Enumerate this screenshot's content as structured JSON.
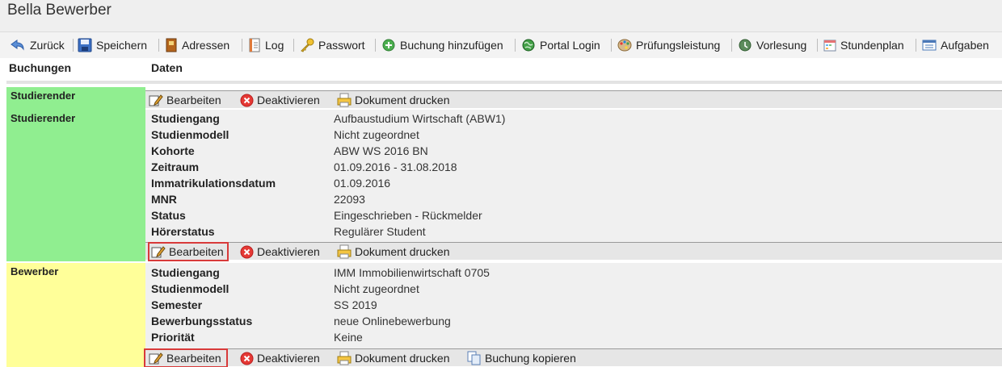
{
  "window": {
    "title": "Bella Bewerber"
  },
  "toolbar": {
    "items": [
      {
        "label": "Zurück",
        "icon": "back-arrow-icon"
      },
      {
        "label": "Speichern",
        "icon": "save-icon"
      },
      {
        "label": "Adressen",
        "icon": "address-book-icon"
      },
      {
        "label": "Log",
        "icon": "log-icon"
      },
      {
        "label": "Passwort",
        "icon": "key-icon"
      },
      {
        "label": "Buchung hinzufügen",
        "icon": "add-icon"
      },
      {
        "label": "Portal Login",
        "icon": "globe-icon"
      },
      {
        "label": "Prüfungsleistung",
        "icon": "palette-icon"
      },
      {
        "label": "Vorlesung",
        "icon": "lecture-icon"
      },
      {
        "label": "Stundenplan",
        "icon": "calendar-icon"
      },
      {
        "label": "Aufgaben",
        "icon": "tasks-icon"
      }
    ]
  },
  "columns": {
    "buchungen": "Buchungen",
    "daten": "Daten"
  },
  "actions": {
    "edit": "Bearbeiten",
    "deactivate": "Deaktivieren",
    "print": "Dokument drucken",
    "copy": "Buchung kopieren"
  },
  "rows": [
    {
      "type": "Studierender"
    },
    {
      "type": "Studierender",
      "fields": [
        {
          "label": "Studiengang",
          "value": "Aufbaustudium Wirtschaft (ABW1)"
        },
        {
          "label": "Studienmodell",
          "value": "Nicht zugeordnet"
        },
        {
          "label": "Kohorte",
          "value": "ABW WS 2016 BN"
        },
        {
          "label": "Zeitraum",
          "value": "01.09.2016 - 31.08.2018"
        },
        {
          "label": "Immatrikulationsdatum",
          "value": "01.09.2016"
        },
        {
          "label": "MNR",
          "value": "22093"
        },
        {
          "label": "Status",
          "value": "Eingeschrieben - Rückmelder"
        },
        {
          "label": "Hörerstatus",
          "value": "Regulärer Student"
        }
      ]
    },
    {
      "type": "Bewerber",
      "fields": [
        {
          "label": "Studiengang",
          "value": "IMM Immobilienwirtschaft 0705"
        },
        {
          "label": "Studienmodell",
          "value": "Nicht zugeordnet"
        },
        {
          "label": "Semester",
          "value": "SS 2019"
        },
        {
          "label": "Bewerbungsstatus",
          "value": "neue Onlinebewerbung"
        },
        {
          "label": "Priorität",
          "value": "Keine"
        }
      ]
    }
  ],
  "colors": {
    "studierender_bg": "#90ee90",
    "bewerber_bg": "#ffff99",
    "highlight": "#d83a3a"
  }
}
